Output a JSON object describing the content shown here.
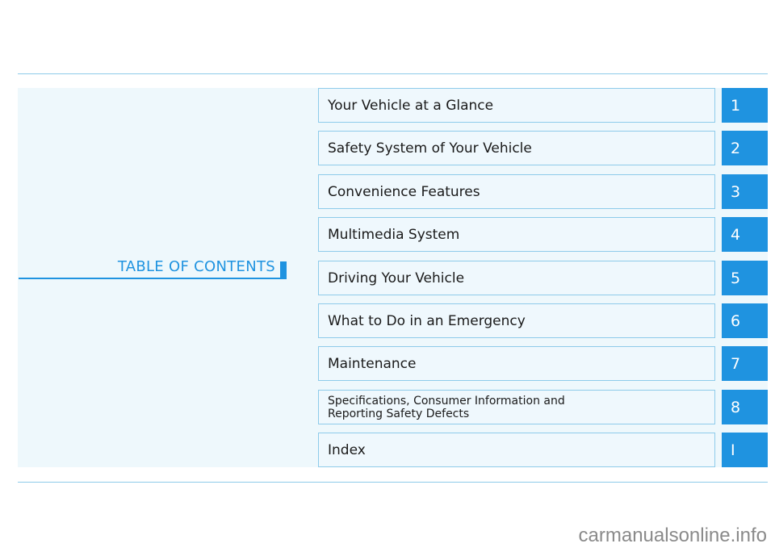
{
  "heading": "TABLE OF CONTENTS",
  "chapters": [
    {
      "label": "Your Vehicle at a Glance",
      "number": "1"
    },
    {
      "label": "Safety System of Your Vehicle",
      "number": "2"
    },
    {
      "label": "Convenience Features",
      "number": "3"
    },
    {
      "label": "Multimedia System",
      "number": "4"
    },
    {
      "label": "Driving Your Vehicle",
      "number": "5"
    },
    {
      "label": "What to Do in an Emergency",
      "number": "6"
    },
    {
      "label": "Maintenance",
      "number": "7"
    },
    {
      "label": "Specifications, Consumer Information and\nReporting Safety Defects",
      "number": "8"
    },
    {
      "label": "Index",
      "number": "I"
    }
  ],
  "watermark": "carmanualsonline.info",
  "colors": {
    "accent": "#1f93e0",
    "panel_bg": "#eef8fc",
    "border": "#8ecbea"
  }
}
